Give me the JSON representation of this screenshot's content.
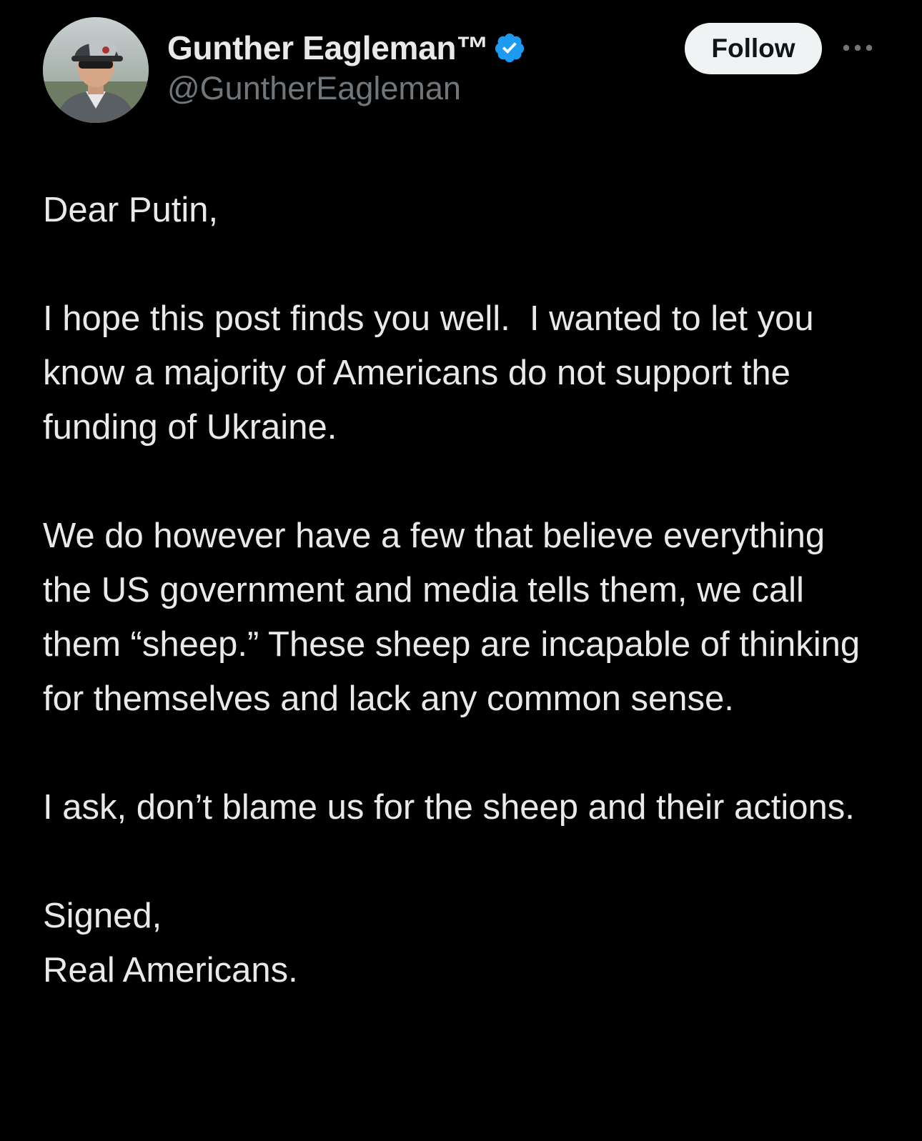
{
  "author": {
    "display_name": "Gunther Eagleman™",
    "handle": "@GuntherEagleman",
    "verified": true,
    "avatar_icon": "profile-photo"
  },
  "actions": {
    "follow_label": "Follow",
    "more_icon": "more-dots-icon"
  },
  "colors": {
    "background": "#000000",
    "text": "#e7e9ea",
    "secondary_text": "#71767b",
    "verified_badge": "#1d9bf0",
    "follow_button_bg": "#eff3f4",
    "follow_button_text": "#0f1419"
  },
  "post": {
    "paragraphs": [
      "Dear Putin,",
      "I hope this post finds you well.  I wanted to let you know a majority of Americans do not support the funding of Ukraine.",
      "We do however have a few that believe everything the US government and media tells them, we call them “sheep.” These sheep are incapable of thinking for themselves and lack any common sense.",
      "I ask, don’t blame us for the sheep and their actions.",
      "Signed,\nReal Americans."
    ]
  }
}
